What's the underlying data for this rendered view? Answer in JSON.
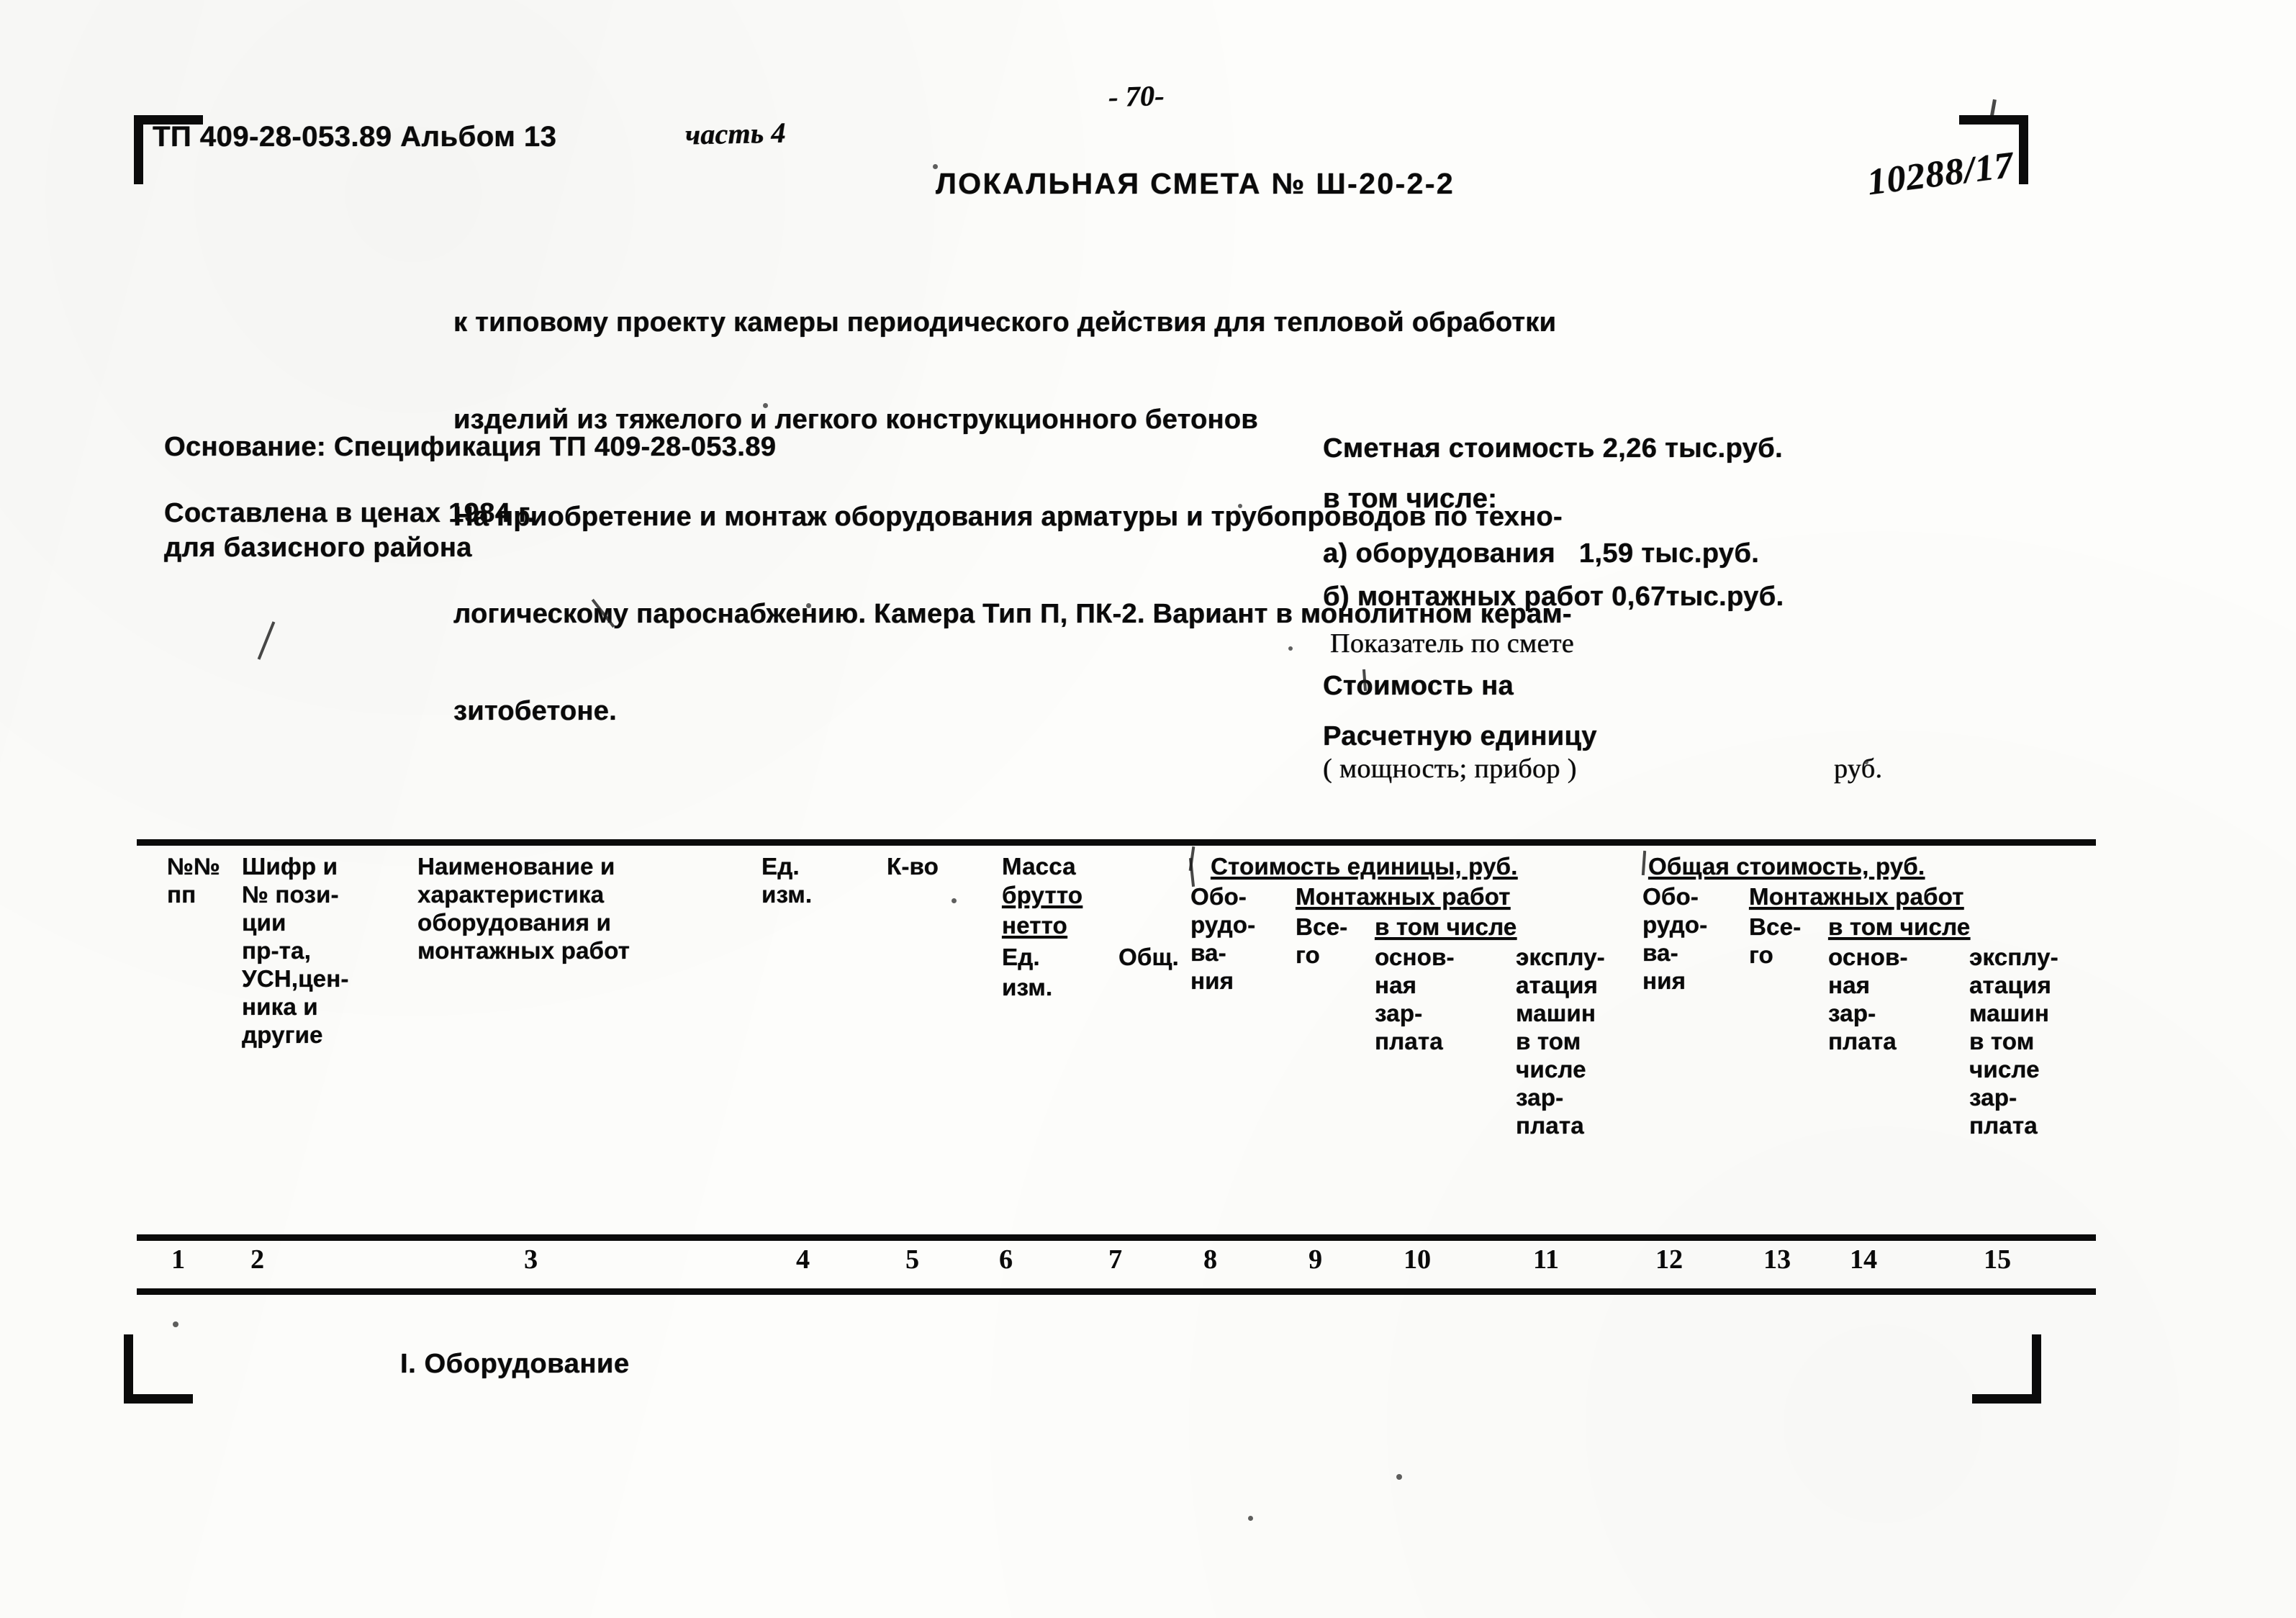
{
  "document": {
    "album_code": "ТП 409-28-053.89 Альбом 13",
    "album_part": "часть 4",
    "page_number": "- 70-",
    "archive_number": "10288/17",
    "title": "ЛОКАЛЬНАЯ СМЕТА № Ш-20-2-2",
    "description_lines": [
      "к типовому проекту камеры периодического действия для тепловой обработки",
      "изделий из тяжелого и легкого конструкционного бетонов",
      "На приобретение и монтаж оборудования арматуры и трубопроводов по техно-",
      "логическому пароснабжению. Камера Тип П, ПК-2. Вариант в монолитном керам-",
      "зитобетоне."
    ]
  },
  "left_info": {
    "basis": "Основание: Спецификация ТП 409-28-053.89",
    "compiled_prices": "Составлена в ценах 1984 г.",
    "compiled_region": "для базисного района"
  },
  "right_info": {
    "total_cost": "Сметная стоимость 2,26 тыс.руб.",
    "including_label": "в том числе:",
    "item_a": "а) оборудования   1,59 тыс.руб.",
    "item_b": "б) монтажных работ 0,67тыс.руб.",
    "indicator_label": "Показатель по смете",
    "cost_on_label": "Стоимость на",
    "unit_label": "Расчетную единицу",
    "unit_sub": "( мощность; прибор )",
    "unit_currency": "руб."
  },
  "table": {
    "headers": {
      "c1": "№№\nпп",
      "c2": "Шифр и\n№ пози-\nции\nпр-та,\nУСН,цен-\nника и\nдругие",
      "c3": "Наименование и\nхарактеристика\nоборудования и\nмонтажных работ",
      "c4": "Ед.\nизм.",
      "c5": "К-во",
      "c6_title": "Масса",
      "c6_brutto": "брутто",
      "c6_netto": "нетто",
      "c6_ed": "Ед.",
      "c6_izm": "изм.",
      "c7_obsh": "Общ.",
      "group1_title": "Стоимость единицы, руб.",
      "group1_equipment": "Обо-\nрудо-\nва-\nния",
      "group1_install": "Монтажных работ",
      "group1_total": "Все-\nго",
      "group1_incl": "в том числе",
      "group1_basic_wage": "основ-\nная\nзар-\nплата",
      "group1_machines": "эксплу-\nатация\nмашин\nв том\nчисле\nзар-\nплата",
      "group2_title": "Общая стоимость, руб.",
      "group2_equipment": "Обо-\nрудо-\nва-\nния",
      "group2_install": "Монтажных работ",
      "group2_total": "Все-\nго",
      "group2_incl": "в том числе",
      "group2_basic_wage": "основ-\nная\nзар-\nплата",
      "group2_machines": "эксплу-\nатация\nмашин\nв том\nчисле\nзар-\nплата"
    },
    "column_numbers": [
      "1",
      "2",
      "3",
      "4",
      "5",
      "6",
      "7",
      "8",
      "9",
      "10",
      "11",
      "12",
      "13",
      "14",
      "15"
    ],
    "section_title": "I. Оборудование"
  }
}
